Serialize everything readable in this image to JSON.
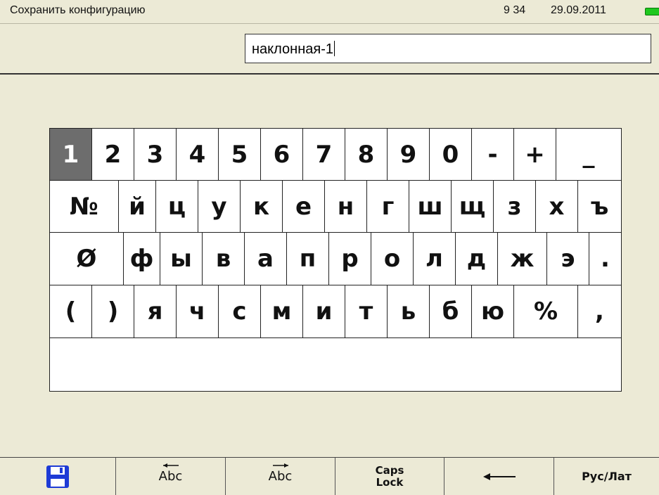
{
  "header": {
    "title": "Сохранить конфигурацию",
    "time": "9 34",
    "date": "29.09.2011",
    "battery_icon": "battery-icon",
    "battery_color": "#1fc81f"
  },
  "input": {
    "value": "наклонная-1"
  },
  "keyboard": {
    "selected_key": "1",
    "rows": [
      [
        "1",
        "2",
        "3",
        "4",
        "5",
        "6",
        "7",
        "8",
        "9",
        "0",
        "-",
        "+",
        "_"
      ],
      [
        "№",
        "й",
        "ц",
        "у",
        "к",
        "е",
        "н",
        "г",
        "ш",
        "щ",
        "з",
        "х",
        "ъ"
      ],
      [
        "Ø",
        "ф",
        "ы",
        "в",
        "а",
        "п",
        "р",
        "о",
        "л",
        "д",
        "ж",
        "э",
        "."
      ],
      [
        "(",
        ")",
        "я",
        "ч",
        "с",
        "м",
        "и",
        "т",
        "ь",
        "б",
        "ю",
        "%",
        ","
      ]
    ]
  },
  "toolbar": {
    "save_icon": "floppy-disk-icon",
    "cursor_left_label": "Abc",
    "cursor_right_label": "Abc",
    "caps_lock_label": "Caps\nLock",
    "backspace_icon": "arrow-left-icon",
    "language_label": "Рус/Лат"
  }
}
